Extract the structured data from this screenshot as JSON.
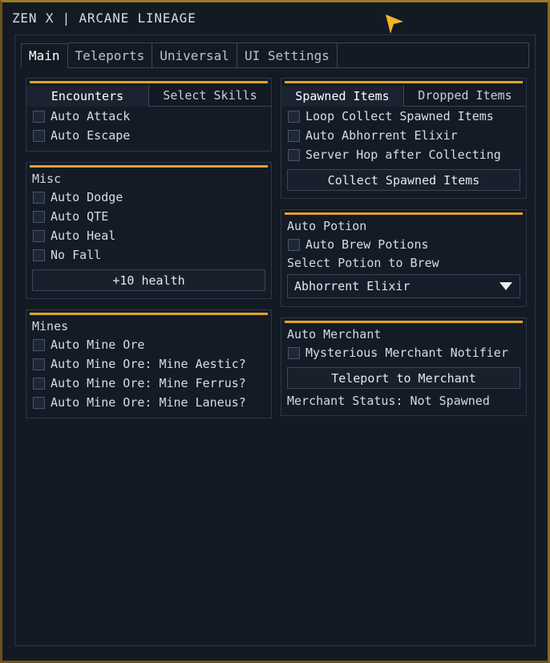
{
  "window": {
    "title": "ZEN X | ARCANE LINEAGE",
    "accent_color": "#e0a22a",
    "border_color": "#8a6a22",
    "background_color": "#131a24",
    "cursor_icon": "cursor-arrow-icon"
  },
  "tabs": [
    {
      "label": "Main",
      "active": true
    },
    {
      "label": "Teleports",
      "active": false
    },
    {
      "label": "Universal",
      "active": false
    },
    {
      "label": "UI Settings",
      "active": false
    }
  ],
  "left_column": {
    "encounters_panel": {
      "subtabs": [
        {
          "label": "Encounters",
          "active": true
        },
        {
          "label": "Select Skills",
          "active": false
        }
      ],
      "checkboxes": [
        {
          "label": "Auto Attack",
          "checked": false
        },
        {
          "label": "Auto Escape",
          "checked": false
        }
      ]
    },
    "misc_panel": {
      "title": "Misc",
      "checkboxes": [
        {
          "label": "Auto Dodge",
          "checked": false
        },
        {
          "label": "Auto QTE",
          "checked": false
        },
        {
          "label": "Auto Heal",
          "checked": false
        },
        {
          "label": "No Fall",
          "checked": false
        }
      ],
      "button": "+10 health"
    },
    "mines_panel": {
      "title": "Mines",
      "checkboxes": [
        {
          "label": "Auto Mine Ore",
          "checked": false
        },
        {
          "label": "Auto Mine Ore: Mine Aestic?",
          "checked": false
        },
        {
          "label": "Auto Mine Ore: Mine Ferrus?",
          "checked": false
        },
        {
          "label": "Auto Mine Ore: Mine Laneus?",
          "checked": false
        }
      ]
    }
  },
  "right_column": {
    "items_panel": {
      "subtabs": [
        {
          "label": "Spawned Items",
          "active": true
        },
        {
          "label": "Dropped Items",
          "active": false
        }
      ],
      "checkboxes": [
        {
          "label": "Loop Collect Spawned Items",
          "checked": false
        },
        {
          "label": "Auto Abhorrent Elixir",
          "checked": false
        },
        {
          "label": "Server Hop after Collecting",
          "checked": false
        }
      ],
      "button": "Collect Spawned Items"
    },
    "potion_panel": {
      "title": "Auto Potion",
      "checkboxes": [
        {
          "label": "Auto Brew Potions",
          "checked": false
        }
      ],
      "select_label": "Select Potion to Brew",
      "select_value": "Abhorrent Elixir",
      "caret_icon": "chevron-down-icon"
    },
    "merchant_panel": {
      "title": "Auto Merchant",
      "checkboxes": [
        {
          "label": "Mysterious Merchant Notifier",
          "checked": false
        }
      ],
      "button": "Teleport to Merchant",
      "status": "Merchant Status: Not Spawned"
    }
  }
}
